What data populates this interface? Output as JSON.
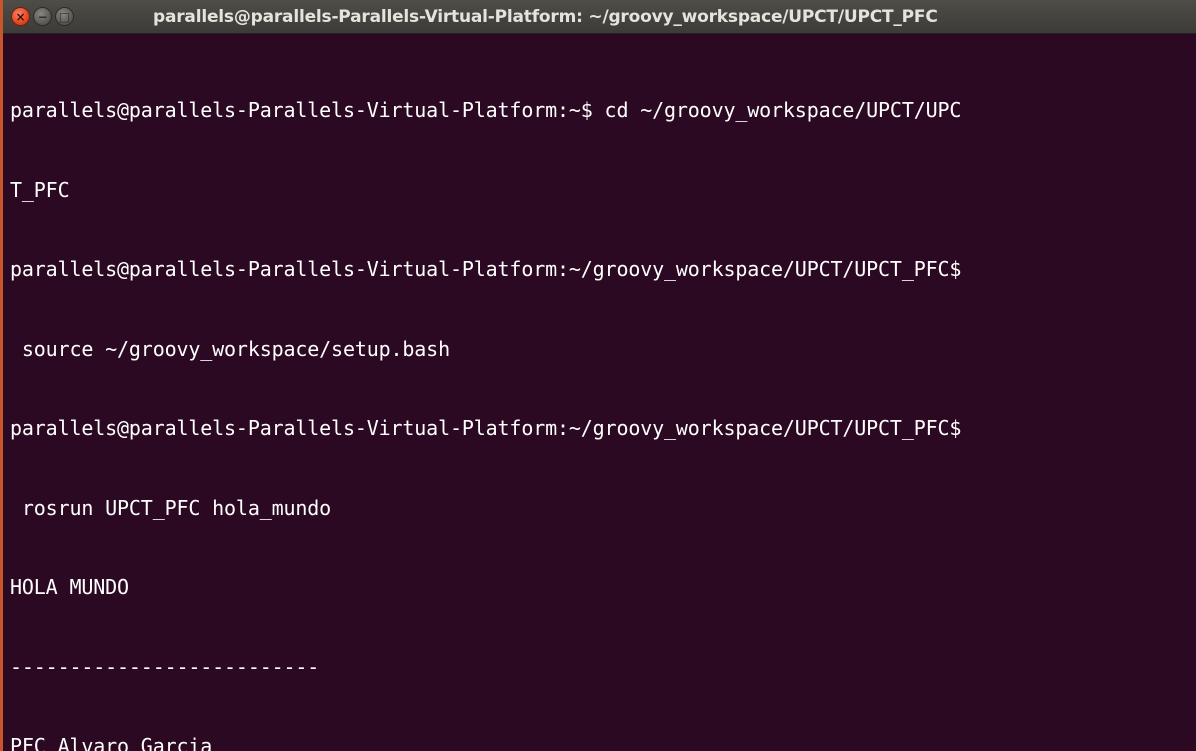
{
  "window": {
    "title": "parallels@parallels-Parallels-Virtual-Platform: ~/groovy_workspace/UPCT/UPCT_PFC",
    "controls": {
      "close_icon": "×",
      "minimize_icon": "−",
      "maximize_icon": "□"
    }
  },
  "terminal": {
    "lines": [
      "parallels@parallels-Parallels-Virtual-Platform:~$ cd ~/groovy_workspace/UPCT/UPC",
      "T_PFC",
      "parallels@parallels-Parallels-Virtual-Platform:~/groovy_workspace/UPCT/UPCT_PFC$",
      " source ~/groovy_workspace/setup.bash",
      "parallels@parallels-Parallels-Virtual-Platform:~/groovy_workspace/UPCT/UPCT_PFC$",
      " rosrun UPCT_PFC hola_mundo",
      "HOLA MUNDO",
      "--------------------------",
      "PFC Alvaro Garcia"
    ]
  },
  "colors": {
    "background": "#2c0922",
    "text": "#ffffff",
    "titlebar": "#3d3b37",
    "close_button": "#e2471f"
  }
}
